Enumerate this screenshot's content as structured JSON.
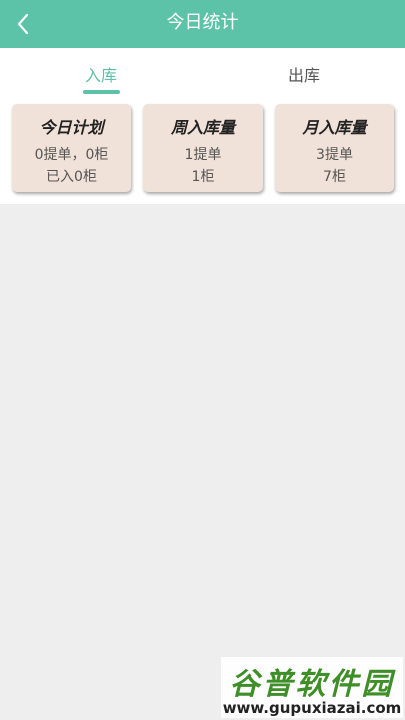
{
  "header": {
    "title": "今日统计",
    "back_icon": "chevron-left-icon"
  },
  "tabs": [
    {
      "label": "入库",
      "active": true
    },
    {
      "label": "出库",
      "active": false
    }
  ],
  "cards": [
    {
      "title": "今日计划",
      "line1": "0提单，0柜",
      "line2": "已入0柜"
    },
    {
      "title": "周入库量",
      "line1": "1提单",
      "line2": "1柜"
    },
    {
      "title": "月入库量",
      "line1": "3提单",
      "line2": "7柜"
    }
  ],
  "watermark": {
    "brand": "谷普软件园",
    "url": "www.gupuxiazai.com"
  },
  "colors": {
    "accent": "#5cc3a8",
    "card_bg": "#f1e2d9",
    "page_bg": "#eeeeee"
  }
}
